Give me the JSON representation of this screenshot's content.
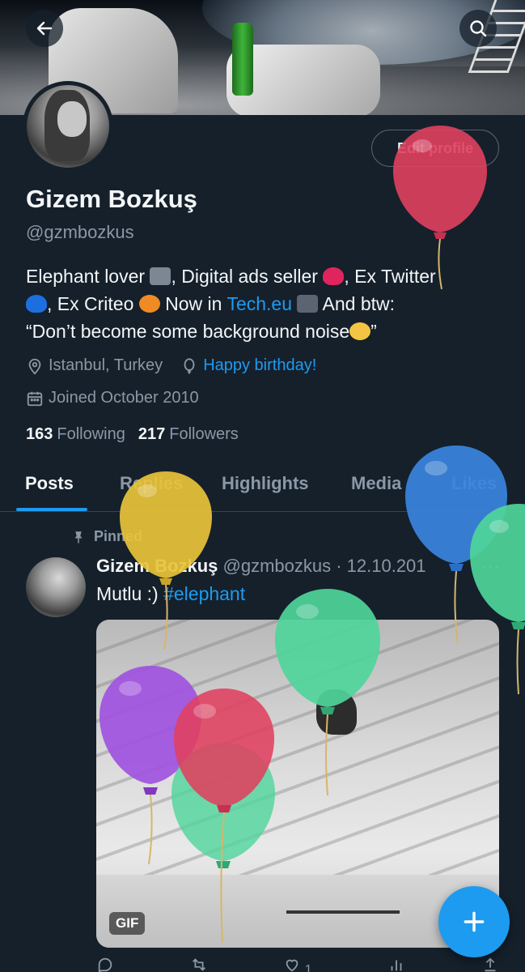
{
  "header": {
    "back_icon": "arrow-left-icon",
    "search_icon": "search-icon"
  },
  "profile": {
    "edit_label": "Edit profile",
    "name": "Gizem Bozkuş",
    "handle": "@gzmbozkus",
    "bio": {
      "part1": "Elephant lover ",
      "part2": ", Digital ads seller ",
      "part3": ", Ex Twitter ",
      "part4": ", Ex Criteo ",
      "part5": " Now in ",
      "link": "Tech.eu",
      "part6": " And btw:",
      "line3": "“Don’t become some background noise",
      "line3_end": "”"
    },
    "location": "Istanbul, Turkey",
    "birthday": "Happy birthday!",
    "joined": "Joined October 2010",
    "following_count": "163",
    "following_label": "Following",
    "followers_count": "217",
    "followers_label": "Followers"
  },
  "tabs": [
    {
      "label": "Posts"
    },
    {
      "label": "Replies"
    },
    {
      "label": "Highlights"
    },
    {
      "label": "Media"
    },
    {
      "label": "Likes"
    }
  ],
  "post": {
    "pinned_label": "Pinned",
    "author": "Gizem Bozkuş",
    "meta": "@gzmbozkus · 12.10.201",
    "more": "···",
    "text": "Mutlu :) ",
    "hashtag": "#elephant",
    "media_badge": "GIF",
    "reply_count": "",
    "like_count": "1"
  },
  "colors": {
    "background": "#15202b",
    "accent": "#1d9bf0",
    "muted": "#8b98a5",
    "border": "#38444d"
  }
}
